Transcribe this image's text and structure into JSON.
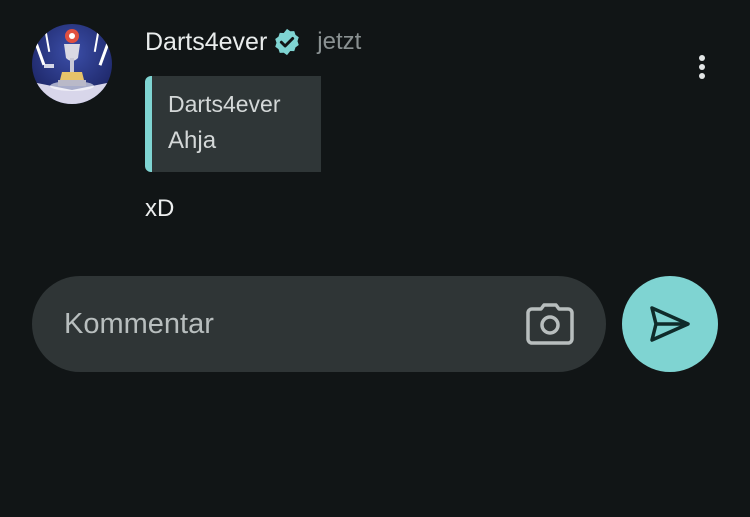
{
  "post": {
    "username": "Darts4ever",
    "verified_icon": "verified-badge-icon",
    "timestamp": "jetzt",
    "more_icon": "more-vertical-icon",
    "quote": {
      "author": "Darts4ever",
      "text": "Ahja"
    },
    "message": "xD"
  },
  "composer": {
    "placeholder": "Kommentar",
    "camera_icon": "camera-icon",
    "send_icon": "send-icon"
  },
  "colors": {
    "background": "#111516",
    "accent": "#7fd4d2",
    "surface": "#2f3536"
  }
}
